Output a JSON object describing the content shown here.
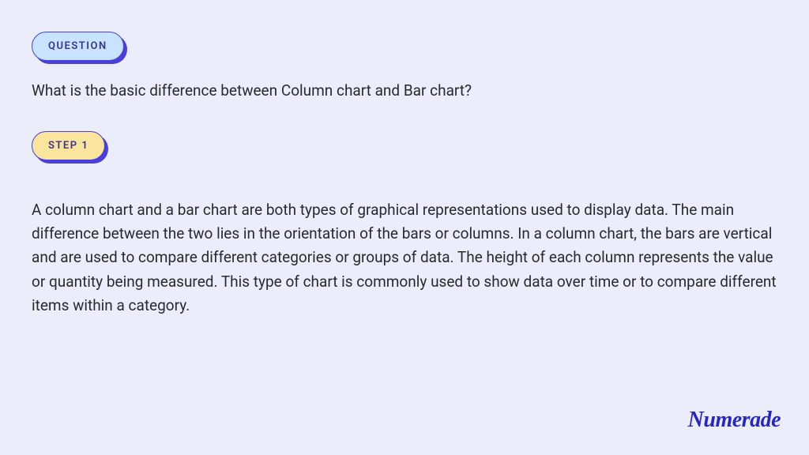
{
  "question": {
    "badge_label": "QUESTION",
    "text": "What is the basic difference between Column chart and Bar chart?"
  },
  "step": {
    "badge_label": "STEP 1",
    "text": "A column chart and a bar chart are both types of graphical representations used to display data. The main difference between the two lies in the orientation of the bars or columns. In a column chart, the bars are vertical and are used to compare different categories or groups of data. The height of each column represents the value or quantity being measured. This type of chart is commonly used to show data over time or to compare different items within a category."
  },
  "brand": "Numerade"
}
